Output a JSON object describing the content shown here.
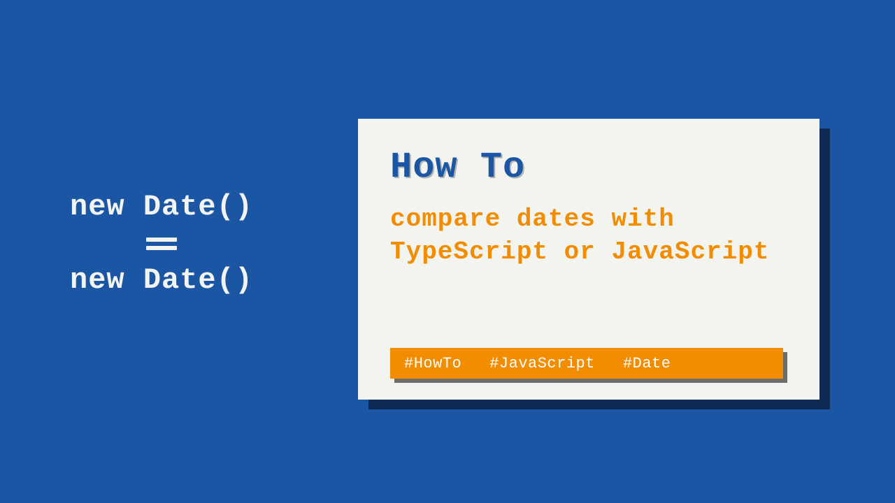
{
  "code": {
    "line1": "new Date()",
    "line2_symbol": "equals",
    "line3": "new Date()"
  },
  "card": {
    "heading": "How To",
    "subheading": "compare dates with TypeScript or JavaScript",
    "tags": [
      "#HowTo",
      "#JavaScript",
      "#Date"
    ]
  }
}
